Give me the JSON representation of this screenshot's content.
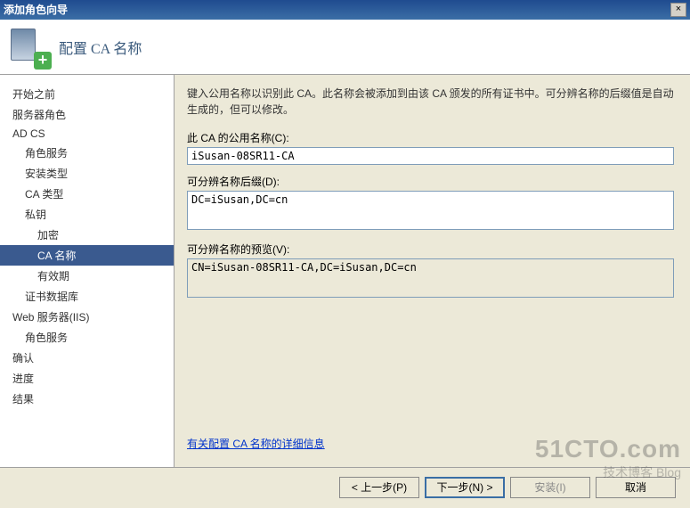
{
  "window": {
    "title": "添加角色向导",
    "close_label": "×"
  },
  "header": {
    "page_title": "配置 CA 名称"
  },
  "sidebar": {
    "items": [
      {
        "label": "开始之前",
        "level": 0
      },
      {
        "label": "服务器角色",
        "level": 0
      },
      {
        "label": "AD CS",
        "level": 0
      },
      {
        "label": "角色服务",
        "level": 1
      },
      {
        "label": "安装类型",
        "level": 1
      },
      {
        "label": "CA 类型",
        "level": 1
      },
      {
        "label": "私钥",
        "level": 1
      },
      {
        "label": "加密",
        "level": 2
      },
      {
        "label": "CA 名称",
        "level": 2,
        "active": true
      },
      {
        "label": "有效期",
        "level": 2
      },
      {
        "label": "证书数据库",
        "level": 1
      },
      {
        "label": "Web 服务器(IIS)",
        "level": 0
      },
      {
        "label": "角色服务",
        "level": 1
      },
      {
        "label": "确认",
        "level": 0
      },
      {
        "label": "进度",
        "level": 0
      },
      {
        "label": "结果",
        "level": 0
      }
    ]
  },
  "main": {
    "instruction": "键入公用名称以识别此 CA。此名称会被添加到由该 CA 颁发的所有证书中。可分辨名称的后缀值是自动生成的，但可以修改。",
    "common_name_label": "此 CA 的公用名称(C):",
    "common_name_value": "iSusan-08SR11-CA",
    "dn_suffix_label": "可分辨名称后缀(D):",
    "dn_suffix_value": "DC=iSusan,DC=cn",
    "dn_preview_label": "可分辨名称的预览(V):",
    "dn_preview_value": "CN=iSusan-08SR11-CA,DC=iSusan,DC=cn",
    "link_text": "有关配置 CA 名称的详细信息"
  },
  "buttons": {
    "prev": "< 上一步(P)",
    "next": "下一步(N) >",
    "install": "安装(I)",
    "cancel": "取消"
  },
  "watermark": {
    "line1": "51CTO.com",
    "line2": "技术博客 Blog"
  }
}
